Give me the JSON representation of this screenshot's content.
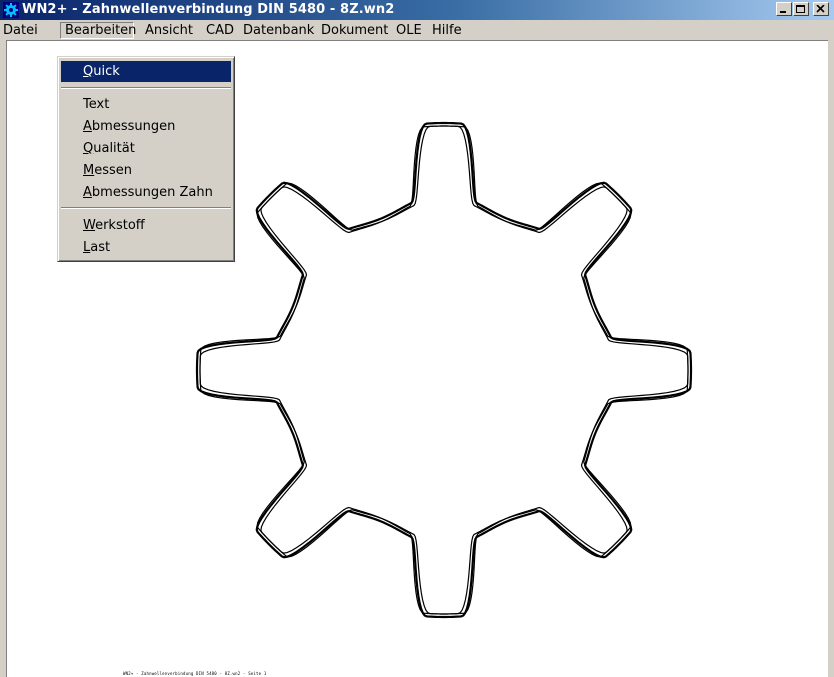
{
  "window": {
    "title": "WN2+ - Zahnwellenverbindung DIN 5480  -  8Z.wn2",
    "icon": "gear-app-icon",
    "accent_color": "#0a246a"
  },
  "menubar": {
    "items": [
      "Datei",
      "Bearbeiten",
      "Ansicht",
      "CAD",
      "Datenbank",
      "Dokument",
      "OLE",
      "Hilfe"
    ],
    "active": "Bearbeiten"
  },
  "dropdown": {
    "items": [
      {
        "mnemonic": "Q",
        "rest": "uick",
        "selected": true
      },
      {
        "mnemonic": "",
        "rest": "Text"
      },
      {
        "mnemonic": "A",
        "rest": "bmessungen"
      },
      {
        "mnemonic": "Q",
        "rest": "ualität"
      },
      {
        "mnemonic": "M",
        "rest": "essen"
      },
      {
        "mnemonic": "A",
        "rest": "bmessungen Zahn"
      },
      {
        "mnemonic": "W",
        "rest": "erkstoff"
      },
      {
        "mnemonic": "L",
        "rest": "ast"
      }
    ]
  },
  "drawing": {
    "teeth": 8,
    "stroke_color": "#000000"
  },
  "footer": {
    "text": "WN2+ - Zahnwellenverbindung DIN 5480 - 8Z.wn2 - Seite 1"
  }
}
